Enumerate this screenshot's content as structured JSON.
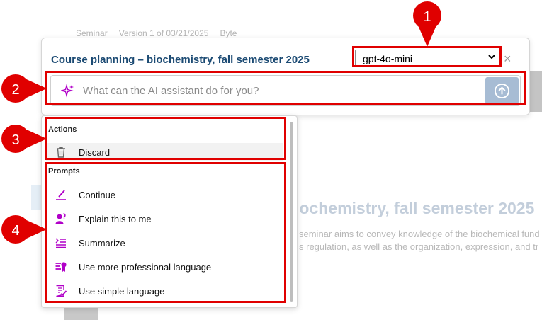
{
  "background": {
    "meta": [
      "Seminar",
      "Version 1 of 03/21/2025",
      "Byte"
    ],
    "heading": "iochemistry, fall semester 2025",
    "para_lines": [
      "seminar aims to convey knowledge of the biochemical fund",
      "s regulation, as well as the organization, expression, and tr"
    ]
  },
  "panel": {
    "title": "Course planning – biochemistry, fall semester 2025",
    "model_select": {
      "value": "gpt-4o-mini"
    },
    "close_symbol": "×",
    "prompt_placeholder": "What can the AI assistant do for you?",
    "prompt_value": ""
  },
  "menu": {
    "actions_label": "Actions",
    "actions": [
      {
        "label": "Discard",
        "icon": "trash-icon"
      }
    ],
    "prompts_label": "Prompts",
    "prompts": [
      {
        "label": "Continue",
        "icon": "pen-icon"
      },
      {
        "label": "Explain this to me",
        "icon": "person-question-icon"
      },
      {
        "label": "Summarize",
        "icon": "summarize-lines-icon"
      },
      {
        "label": "Use more professional language",
        "icon": "certificate-icon"
      },
      {
        "label": "Use simple language",
        "icon": "checklist-document-icon"
      }
    ]
  },
  "annotations": [
    "1",
    "2",
    "3",
    "4"
  ],
  "colors": {
    "annotation": "#e00000",
    "accent": "#b100c8",
    "title": "#1b4a73",
    "send_button": "#a7bcd4"
  }
}
